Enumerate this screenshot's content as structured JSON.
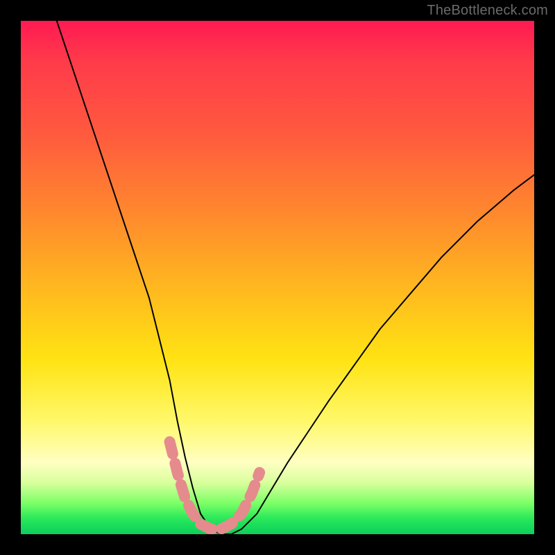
{
  "watermark": "TheBottleneck.com",
  "chart_data": {
    "type": "line",
    "title": "",
    "xlabel": "",
    "ylabel": "",
    "xlim": [
      0,
      100
    ],
    "ylim": [
      0,
      100
    ],
    "legend": false,
    "grid": false,
    "background_gradient": {
      "top": "#ff1a53",
      "mid_orange": "#ff8a2d",
      "mid_yellow": "#ffe313",
      "pale": "#ffffc2",
      "bottom": "#0ccf5c"
    },
    "series": [
      {
        "name": "bottleneck-curve",
        "color": "#000000",
        "x": [
          7,
          10,
          13,
          16,
          19,
          22,
          25,
          27,
          29,
          30.5,
          32,
          33.5,
          35,
          37,
          39,
          41,
          43,
          46,
          49,
          52,
          56,
          60,
          65,
          70,
          76,
          82,
          89,
          96,
          100
        ],
        "y": [
          100,
          91,
          82,
          73,
          64,
          55,
          46,
          38,
          30,
          22,
          15,
          9,
          4,
          1,
          0,
          0,
          1,
          4,
          9,
          14,
          20,
          26,
          33,
          40,
          47,
          54,
          61,
          67,
          70
        ]
      },
      {
        "name": "highlight-band",
        "color": "#e58b8d",
        "note": "thick pink overlay segment near the minimum",
        "x": [
          29,
          30.5,
          32,
          33.5,
          35,
          37,
          39,
          41,
          43,
          45,
          46.5
        ],
        "y": [
          18,
          12,
          7,
          4,
          2,
          1,
          1,
          2,
          4,
          8,
          12
        ]
      }
    ],
    "annotations": []
  }
}
